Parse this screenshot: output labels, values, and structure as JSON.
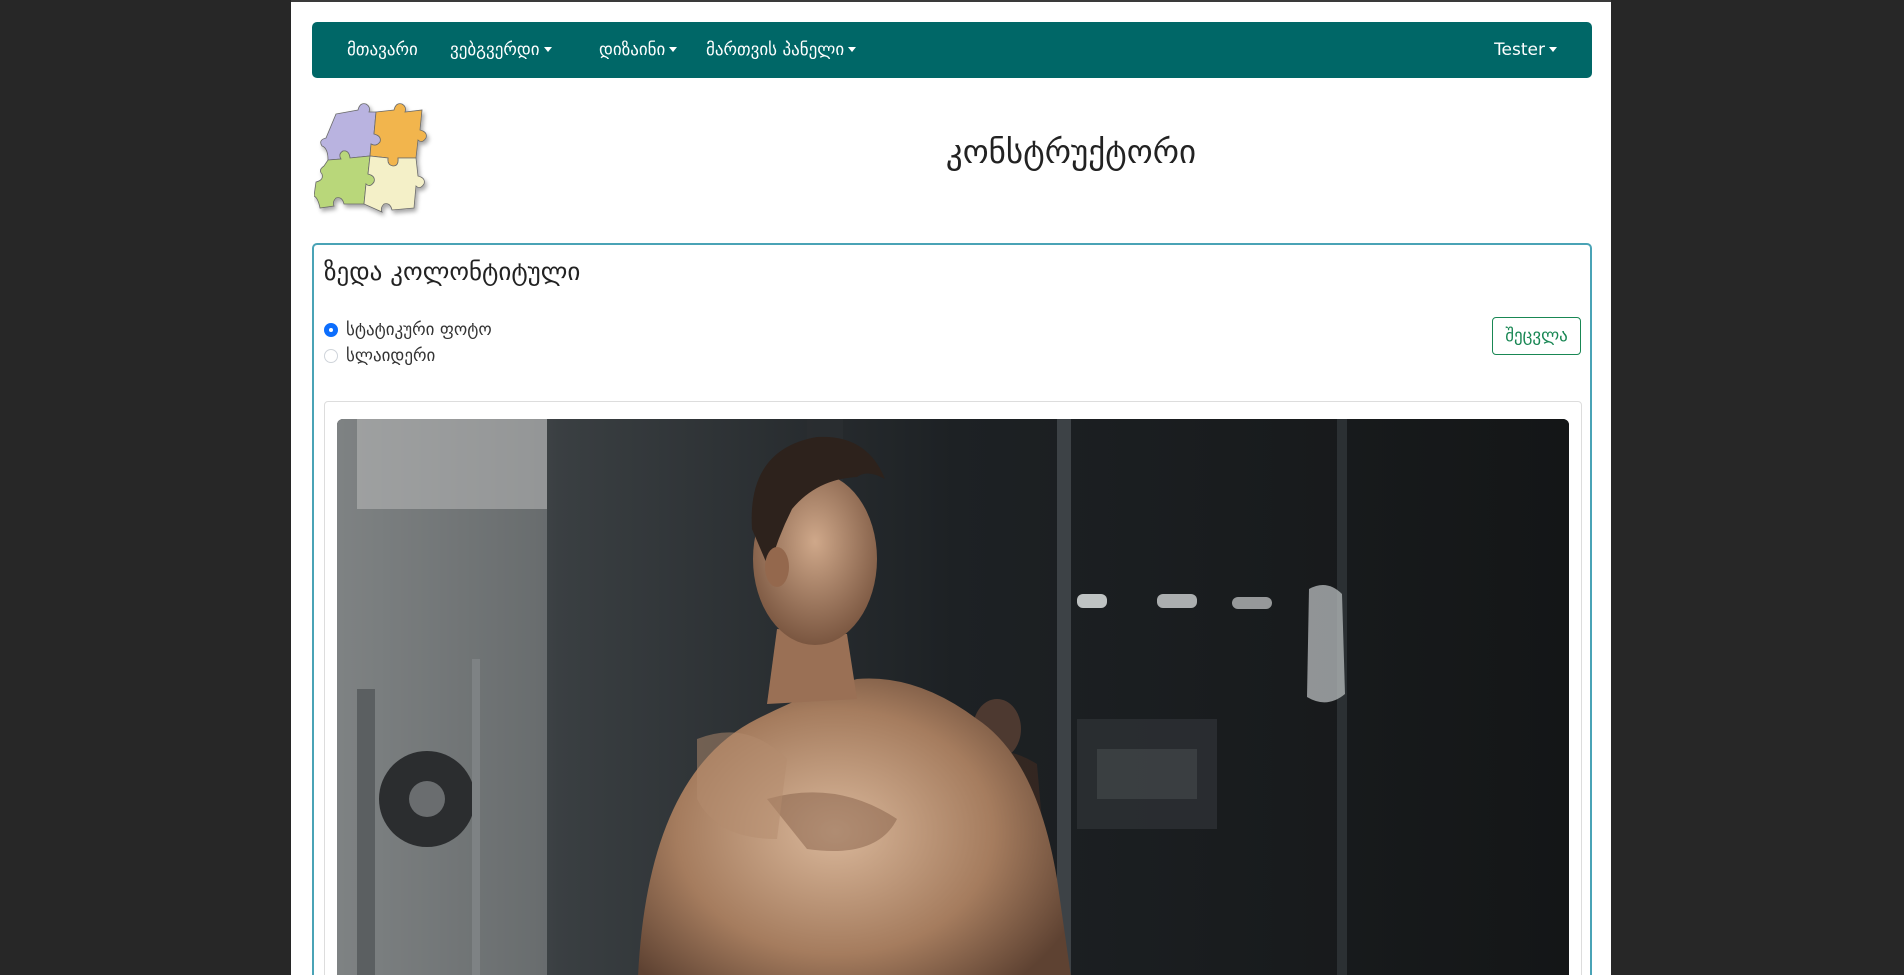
{
  "navbar": {
    "items": [
      {
        "label": "მთავარი",
        "dropdown": false
      },
      {
        "label": "ვებგვერდი",
        "dropdown": true
      },
      {
        "label": "დიზაინი",
        "dropdown": true
      },
      {
        "label": "მართვის პანელი",
        "dropdown": true
      }
    ],
    "user": {
      "label": "Tester",
      "dropdown": true
    }
  },
  "header": {
    "logo_icon": "puzzle-logo",
    "title": "კონსტრუქტორი"
  },
  "card": {
    "title": "ზედა კოლონტიტული",
    "options": [
      {
        "label": "სტატიკური ფოტო",
        "checked": true
      },
      {
        "label": "სლაიდერი",
        "checked": false
      }
    ],
    "change_button": "შეცვლა",
    "image": "gym-man-photo"
  },
  "colors": {
    "navbar": "#006767",
    "card_border": "#4aa3b6",
    "button": "#198754",
    "radio": "#0d6efd",
    "backdrop": "#272727"
  }
}
